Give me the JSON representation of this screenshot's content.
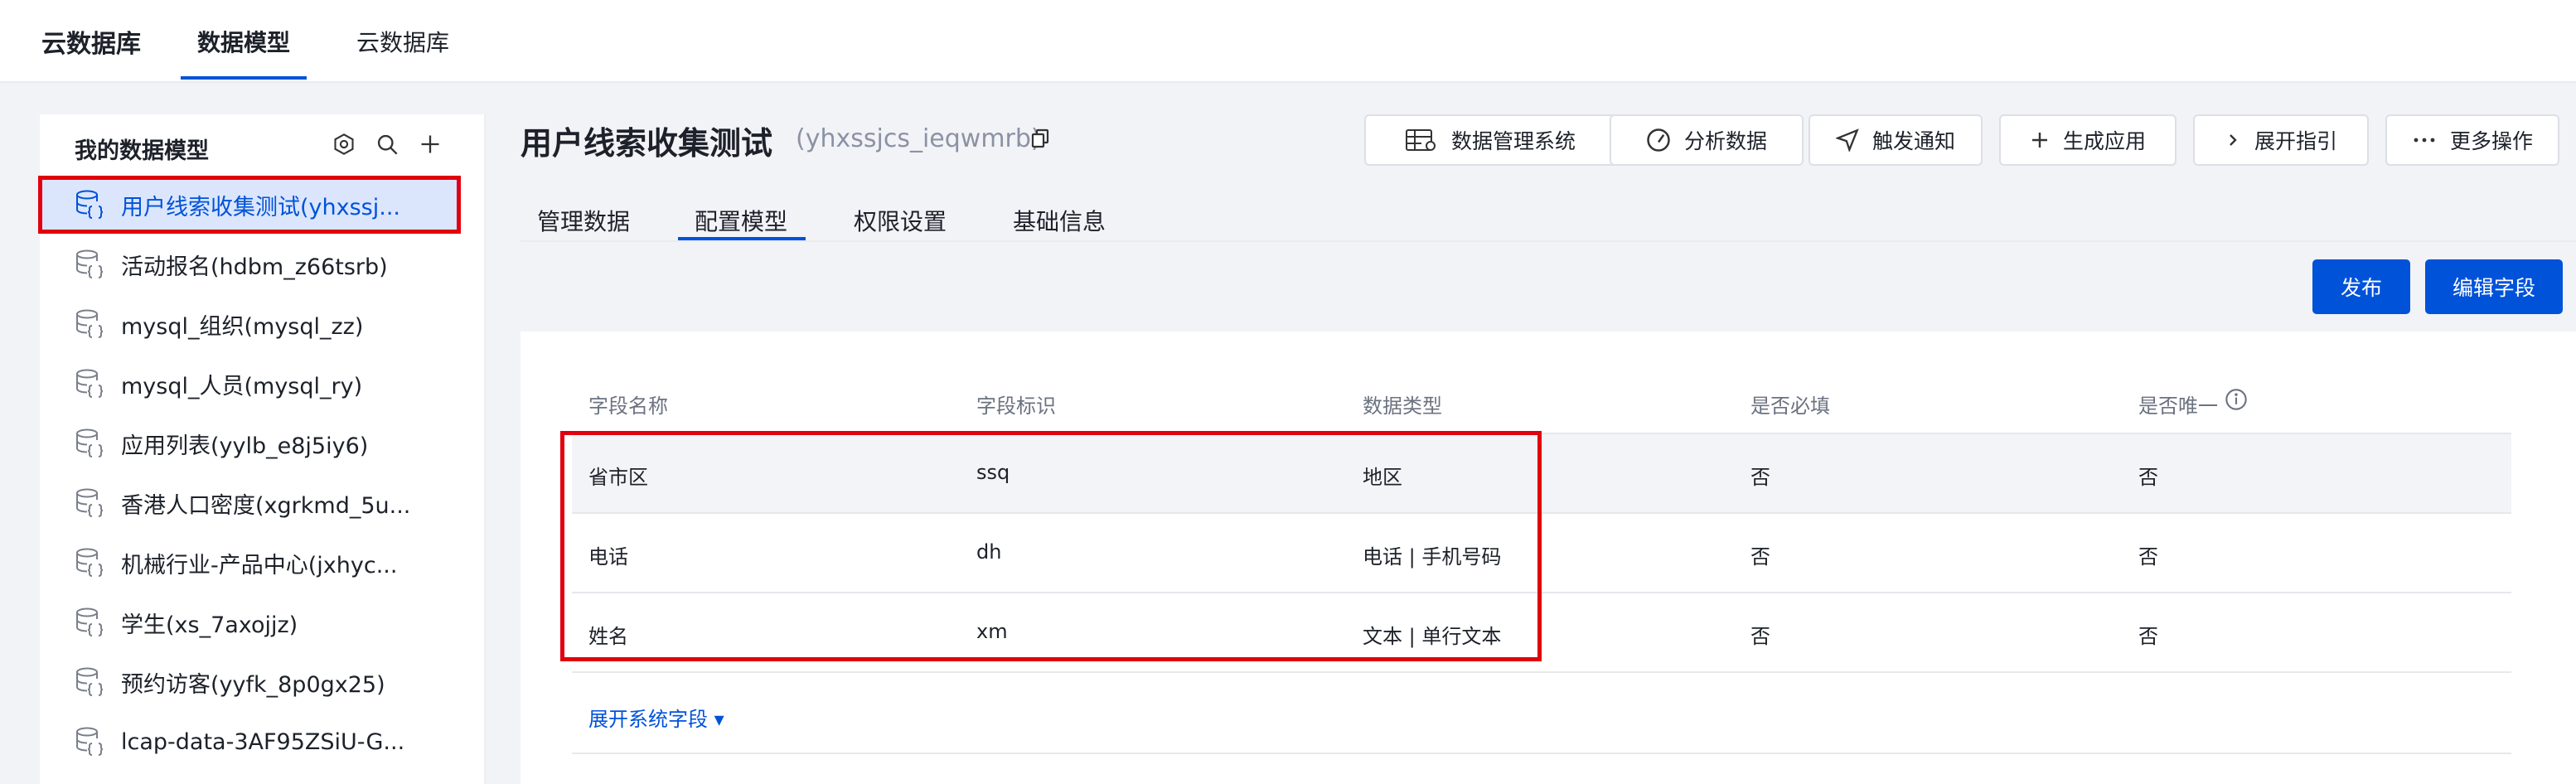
{
  "topnav": {
    "brand": "云数据库",
    "tabs": [
      {
        "label": "数据模型",
        "active": true
      },
      {
        "label": "云数据库",
        "active": false
      }
    ]
  },
  "sidebar": {
    "title": "我的数据模型",
    "tools": [
      "settings-icon",
      "search-icon",
      "plus-icon"
    ],
    "items": [
      {
        "label": "用户线索收集测试(yhxssj...",
        "active": true
      },
      {
        "label": "活动报名(hdbm_z66tsrb)"
      },
      {
        "label": "mysql_组织(mysql_zz)"
      },
      {
        "label": "mysql_人员(mysql_ry)"
      },
      {
        "label": "应用列表(yylb_e8j5iy6)"
      },
      {
        "label": "香港人口密度(xgrkmd_5u..."
      },
      {
        "label": "机械行业-产品中心(jxhyc..."
      },
      {
        "label": "学生(xs_7axojjz)"
      },
      {
        "label": "预约访客(yyfk_8p0gx25)"
      },
      {
        "label": "lcap-data-3AF95ZSiU-G..."
      }
    ]
  },
  "header": {
    "title": "用户线索收集测试",
    "subtitle": "(yhxssjcs_ieqwmrb)",
    "buttons": [
      {
        "label": "数据管理系统",
        "icon": "table-icon"
      },
      {
        "label": "分析数据",
        "icon": "gauge-icon"
      },
      {
        "label": "触发通知",
        "icon": "send-icon"
      },
      {
        "label": "生成应用",
        "icon": "plus-icon"
      },
      {
        "label": "展开指引",
        "icon": "chevron-right-icon"
      },
      {
        "label": "更多操作",
        "icon": "more-icon"
      }
    ]
  },
  "subtabs": [
    {
      "label": "管理数据",
      "active": false
    },
    {
      "label": "配置模型",
      "active": true
    },
    {
      "label": "权限设置",
      "active": false
    },
    {
      "label": "基础信息",
      "active": false
    }
  ],
  "actions": {
    "publish": "发布",
    "edit_fields": "编辑字段"
  },
  "table": {
    "columns": [
      "字段名称",
      "字段标识",
      "数据类型",
      "是否必填",
      "是否唯一"
    ],
    "rows": [
      [
        "省市区",
        "ssq",
        "地区",
        "否",
        "否"
      ],
      [
        "电话",
        "dh",
        "电话 | 手机号码",
        "否",
        "否"
      ],
      [
        "姓名",
        "xm",
        "文本 | 单行文本",
        "否",
        "否"
      ]
    ],
    "expand_label": "展开系统字段 ▾"
  },
  "colors": {
    "accent": "#0052d9",
    "highlight": "#e1000f",
    "active_bg": "#dbe6fd"
  }
}
